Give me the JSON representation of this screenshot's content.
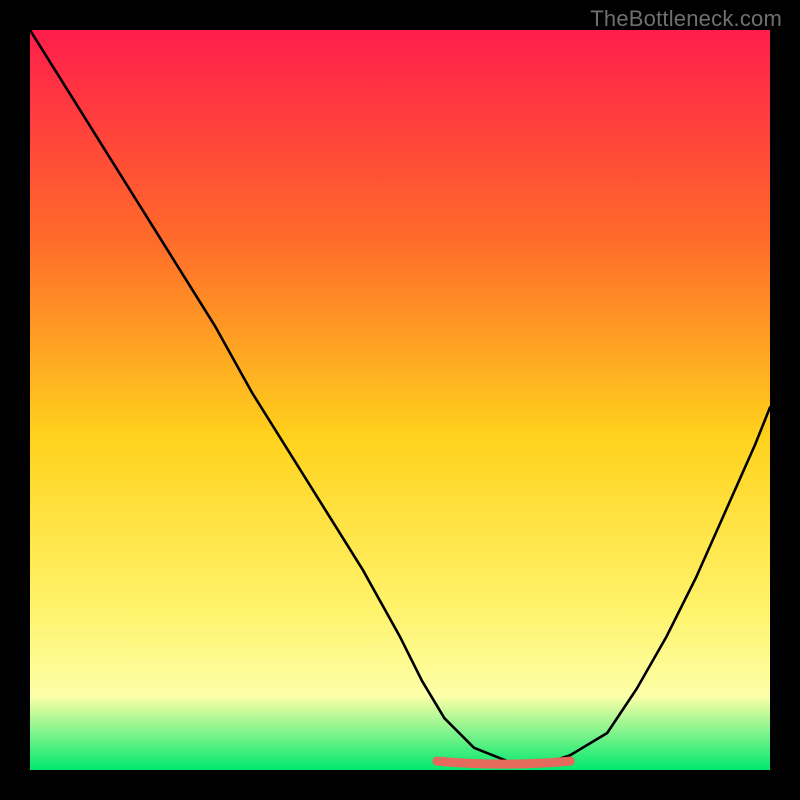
{
  "watermark": "TheBottleneck.com",
  "colors": {
    "frame": "#000000",
    "gradient_top": "#ff1d4b",
    "gradient_mid1": "#ff6a2a",
    "gradient_mid2": "#ffd21c",
    "gradient_mid3": "#fff36a",
    "gradient_mid4": "#fdffa8",
    "gradient_bot": "#00e86f",
    "curve": "#000000",
    "highlight": "#e46a5e",
    "watermark": "#6f6f6f"
  },
  "chart_data": {
    "type": "line",
    "title": "",
    "xlabel": "",
    "ylabel": "",
    "xlim": [
      0,
      100
    ],
    "ylim": [
      0,
      100
    ],
    "series": [
      {
        "name": "curve",
        "x": [
          0,
          5,
          10,
          15,
          20,
          25,
          30,
          35,
          40,
          45,
          50,
          53,
          56,
          60,
          65,
          70,
          73,
          78,
          82,
          86,
          90,
          94,
          98,
          100
        ],
        "values": [
          100,
          92,
          84,
          76,
          68,
          60,
          51,
          43,
          35,
          27,
          18,
          12,
          7,
          3,
          1,
          1,
          2,
          5,
          11,
          18,
          26,
          35,
          44,
          49
        ]
      }
    ],
    "highlight": {
      "x_start": 55,
      "x_end": 73,
      "y": 1.2
    }
  }
}
